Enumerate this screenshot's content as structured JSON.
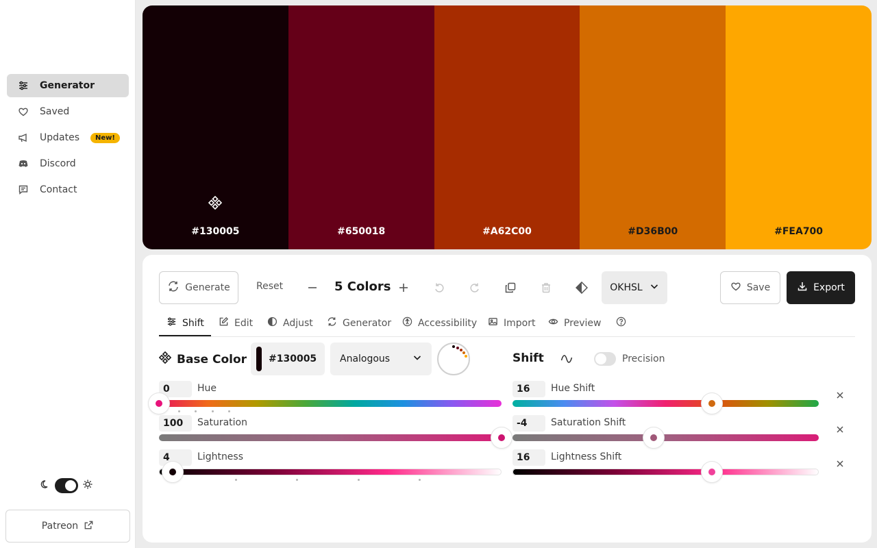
{
  "sidebar": {
    "items": [
      {
        "label": "Generator",
        "icon": "sliders-icon"
      },
      {
        "label": "Saved",
        "icon": "heart-icon"
      },
      {
        "label": "Updates",
        "icon": "megaphone-icon",
        "badge": "New!"
      },
      {
        "label": "Discord",
        "icon": "discord-icon"
      },
      {
        "label": "Contact",
        "icon": "message-icon"
      }
    ],
    "patreon_label": "Patreon"
  },
  "palette": {
    "swatches": [
      {
        "hex": "#130005",
        "text_color": "#ffffff"
      },
      {
        "hex": "#650018",
        "text_color": "#ffffff"
      },
      {
        "hex": "#A62C00",
        "text_color": "#ffffff"
      },
      {
        "hex": "#D36B00",
        "text_color": "#1a1a1a"
      },
      {
        "hex": "#FEA700",
        "text_color": "#1a1a1a"
      }
    ]
  },
  "toolbar": {
    "generate_label": "Generate",
    "reset_label": "Reset",
    "count_label": "5 Colors",
    "color_space": "OKHSL",
    "save_label": "Save",
    "export_label": "Export"
  },
  "tabs": [
    {
      "label": "Shift",
      "icon": "sliders-icon",
      "active": true
    },
    {
      "label": "Edit",
      "icon": "edit-icon"
    },
    {
      "label": "Adjust",
      "icon": "contrast-icon"
    },
    {
      "label": "Generator",
      "icon": "refresh-icon"
    },
    {
      "label": "Accessibility",
      "icon": "accessibility-icon"
    },
    {
      "label": "Import",
      "icon": "image-icon"
    },
    {
      "label": "Preview",
      "icon": "eye-icon"
    },
    {
      "label": "",
      "icon": "help-icon"
    }
  ],
  "base": {
    "title": "Base Color",
    "hex": "#130005",
    "scheme": "Analogous",
    "hue": {
      "value": "0",
      "label": "Hue",
      "fraction": 0.0
    },
    "saturation": {
      "value": "100",
      "label": "Saturation",
      "fraction": 1.0
    },
    "lightness": {
      "value": "4",
      "label": "Lightness",
      "fraction": 0.04
    }
  },
  "shift": {
    "title": "Shift",
    "precision_label": "Precision",
    "hue_shift": {
      "value": "16",
      "label": "Hue Shift",
      "fraction": 0.65
    },
    "saturation_shift": {
      "value": "-4",
      "label": "Saturation Shift",
      "fraction": 0.46
    },
    "lightness_shift": {
      "value": "16",
      "label": "Lightness Shift",
      "fraction": 0.65
    }
  },
  "colors": {
    "accent": "#E8127A",
    "dark": "#1e1e1e",
    "badge": "#f5b400"
  }
}
